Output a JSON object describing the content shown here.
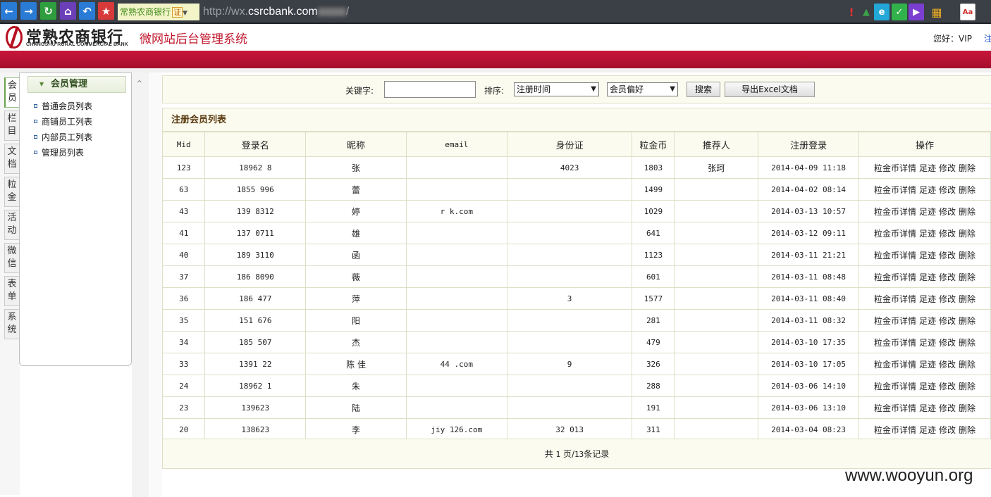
{
  "browser": {
    "site_name": "常熟农商银行",
    "cert_badge": "证",
    "url_prefix": "http://wx.",
    "url_host": "csrcbank.com",
    "url_suffix": "/"
  },
  "header": {
    "logo_cn": "常熟农商银行",
    "logo_en": "CHANGSHU RURAL COMMERCIAL BANK",
    "system_title": "微网站后台管理系统",
    "greeting": "您好：VIP",
    "logout_label": "注"
  },
  "left_tabs": [
    {
      "chars": [
        "会",
        "员"
      ],
      "active": true
    },
    {
      "chars": [
        "栏",
        "目"
      ],
      "active": false
    },
    {
      "chars": [
        "文",
        "档"
      ],
      "active": false
    },
    {
      "chars": [
        "粒",
        "金"
      ],
      "active": false
    },
    {
      "chars": [
        "活",
        "动"
      ],
      "active": false
    },
    {
      "chars": [
        "微",
        "信"
      ],
      "active": false
    },
    {
      "chars": [
        "表",
        "单"
      ],
      "active": false
    },
    {
      "chars": [
        "系",
        "统"
      ],
      "active": false
    }
  ],
  "left_panel": {
    "title": "会员管理",
    "items": [
      "普通会员列表",
      "商铺员工列表",
      "内部员工列表",
      "管理员列表"
    ]
  },
  "search": {
    "keyword_label": "关键字:",
    "keyword_value": "",
    "sort_label": "排序:",
    "sort_selected": "注册时间",
    "preference_selected": "会员偏好",
    "search_button": "搜索",
    "export_button": "导出Excel文档"
  },
  "list": {
    "title": "注册会员列表",
    "columns": [
      "Mid",
      "登录名",
      "昵称",
      "email",
      "身份证",
      "粒金币",
      "推荐人",
      "注册登录",
      "操作"
    ],
    "actions": [
      "粒金币详情",
      "足迹",
      "修改",
      "删除"
    ],
    "rows": [
      {
        "mid": "123",
        "login": "18962    8",
        "nick": "张",
        "email": "",
        "id_card": "4023",
        "coins": "1803",
        "referrer": "张珂",
        "registered": "2014-04-09 11:18"
      },
      {
        "mid": "63",
        "login": "1855  996",
        "nick": "蕾",
        "email": "",
        "id_card": "",
        "coins": "1499",
        "referrer": "",
        "registered": "2014-04-02 08:14"
      },
      {
        "mid": "43",
        "login": "139  8312",
        "nick": "婷",
        "email": "r          k.com",
        "id_card": "",
        "coins": "1029",
        "referrer": "",
        "registered": "2014-03-13 10:57"
      },
      {
        "mid": "41",
        "login": "137  0711",
        "nick": "雄",
        "email": "",
        "id_card": "",
        "coins": "641",
        "referrer": "",
        "registered": "2014-03-12 09:11"
      },
      {
        "mid": "40",
        "login": "189  3110",
        "nick": "函",
        "email": "",
        "id_card": "",
        "coins": "1123",
        "referrer": "",
        "registered": "2014-03-11 21:21"
      },
      {
        "mid": "37",
        "login": "186  8090",
        "nick": "薇",
        "email": "",
        "id_card": "",
        "coins": "601",
        "referrer": "",
        "registered": "2014-03-11 08:48"
      },
      {
        "mid": "36",
        "login": "186  477",
        "nick": "萍",
        "email": "",
        "id_card": "3",
        "coins": "1577",
        "referrer": "",
        "registered": "2014-03-11 08:40"
      },
      {
        "mid": "35",
        "login": "151  676",
        "nick": "阳",
        "email": "",
        "id_card": "",
        "coins": "281",
        "referrer": "",
        "registered": "2014-03-11 08:32"
      },
      {
        "mid": "34",
        "login": "185  507",
        "nick": "杰",
        "email": "",
        "id_card": "",
        "coins": "479",
        "referrer": "",
        "registered": "2014-03-10 17:35"
      },
      {
        "mid": "33",
        "login": "1391  22",
        "nick": "陈 佳",
        "email": "44      .com",
        "id_card": "9",
        "coins": "326",
        "referrer": "",
        "registered": "2014-03-10 17:05"
      },
      {
        "mid": "24",
        "login": "18962  1",
        "nick": "朱",
        "email": "",
        "id_card": "",
        "coins": "288",
        "referrer": "",
        "registered": "2014-03-06 14:10"
      },
      {
        "mid": "23",
        "login": "139623",
        "nick": "陆",
        "email": "",
        "id_card": "",
        "coins": "191",
        "referrer": "",
        "registered": "2014-03-06 13:10"
      },
      {
        "mid": "20",
        "login": "138623",
        "nick": "李",
        "email": "jiy     126.com",
        "id_card": "32      013",
        "coins": "311",
        "referrer": "",
        "registered": "2014-03-04 08:23"
      }
    ]
  },
  "pager": {
    "prefix": "共",
    "pages": "1",
    "mid": "页/",
    "records": "13",
    "suffix": "条记录"
  },
  "watermark": "www.wooyun.org",
  "colors": {
    "brand_red": "#c0182e",
    "panel_bg": "#fbfbef",
    "border": "#dedfc6"
  }
}
